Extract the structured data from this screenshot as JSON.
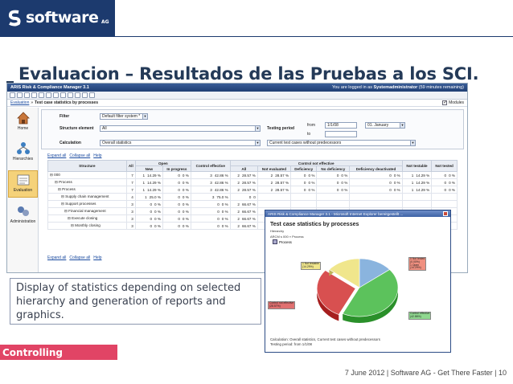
{
  "logo": {
    "text": "software",
    "suffix": "AG"
  },
  "slide": {
    "title": "Evaluacion – Resultados de las Pruebas a los SCI."
  },
  "app": {
    "title": "ARIS Risk & Compliance Manager 3.1",
    "login_prefix": "You are logged in as",
    "login_user": "Systemadministrator",
    "login_suffix": "(59 minutes remaining)",
    "breadcrumb": [
      "Evaluation",
      "Test case statistics by processes"
    ],
    "modules_label": "Modules",
    "sidebar": [
      {
        "label": "Home",
        "icon": "home-icon"
      },
      {
        "label": "Hierarchies",
        "icon": "hierarchy-icon"
      },
      {
        "label": "Evaluation",
        "icon": "evaluation-icon",
        "active": true
      },
      {
        "label": "Administration",
        "icon": "administration-icon"
      }
    ],
    "filter": {
      "filter_label": "Filter",
      "filter_value": "Default filter system *",
      "structure_label": "Structure element",
      "structure_value": "All",
      "period_label": "Testing period",
      "from_label": "from",
      "from_value": "1/1/08",
      "to_label": "to",
      "month_value": "01. January",
      "calc_label": "Calculation",
      "calc_value": "Overall statistics",
      "calc_value2": "Current test cases without predecessors"
    },
    "tools": {
      "expand": "Expand all",
      "collapse": "Collapse all",
      "help": "Help"
    },
    "table": {
      "headers": {
        "structure": "Structure",
        "all": "All",
        "open": "Open",
        "not_effective": "Control not effective",
        "control_effective": "Control effective",
        "not_testable": "Not testable",
        "not_tested": "Not tested",
        "new": "New",
        "in_progress": "In progress",
        "all2": "All",
        "not_evaluated": "Not evaluated",
        "deficiency": "Deficiency",
        "no_deficiency": "No deficiency",
        "def_deactivated": "Deficiency deactivated"
      },
      "rows": [
        {
          "name": "000",
          "all": "7",
          "new_n": "1",
          "new_p": "14.29 %",
          "ip_n": "0",
          "ip_p": "0 %",
          "ce_n": "3",
          "ce_p": "42.86 %",
          "ne_n": "2",
          "ne_p": "28.57 %",
          "nev_n": "2",
          "nev_p": "28.57 %",
          "d_n": "0",
          "d_p": "0 %",
          "nd_n": "0",
          "nd_p": "0 %",
          "dd_n": "0",
          "dd_p": "0 %",
          "nt_n": "1",
          "nt_p": "14.29 %",
          "nts_n": "0",
          "nts_p": "0 %"
        },
        {
          "name": "Process",
          "all": "7",
          "new_n": "1",
          "new_p": "14.29 %",
          "ip_n": "0",
          "ip_p": "0 %",
          "ce_n": "3",
          "ce_p": "42.86 %",
          "ne_n": "2",
          "ne_p": "28.57 %",
          "nev_n": "2",
          "nev_p": "28.57 %",
          "d_n": "0",
          "d_p": "0 %",
          "nd_n": "0",
          "nd_p": "0 %",
          "dd_n": "0",
          "dd_p": "0 %",
          "nt_n": "1",
          "nt_p": "14.29 %",
          "nts_n": "0",
          "nts_p": "0 %"
        },
        {
          "name": "Process",
          "all": "7",
          "new_n": "1",
          "new_p": "14.29 %",
          "ip_n": "0",
          "ip_p": "0 %",
          "ce_n": "3",
          "ce_p": "42.86 %",
          "ne_n": "2",
          "ne_p": "28.57 %",
          "nev_n": "2",
          "nev_p": "28.57 %",
          "d_n": "0",
          "d_p": "0 %",
          "nd_n": "0",
          "nd_p": "0 %",
          "dd_n": "0",
          "dd_p": "0 %",
          "nt_n": "1",
          "nt_p": "14.29 %",
          "nts_n": "0",
          "nts_p": "0 %"
        },
        {
          "name": "Supply chain management",
          "all": "4",
          "new_n": "1",
          "new_p": "25.0 %",
          "ip_n": "0",
          "ip_p": "0 %",
          "ce_n": "3",
          "ce_p": "75.0 %",
          "ne_n": "0",
          "ne_p": "0",
          "nev_n": "",
          "nev_p": "",
          "d_n": "",
          "d_p": "",
          "nd_n": "",
          "nd_p": "",
          "dd_n": "",
          "dd_p": "",
          "nt_n": "",
          "nt_p": "",
          "nts_n": "",
          "nts_p": ""
        },
        {
          "name": "Support processes",
          "all": "3",
          "new_n": "0",
          "new_p": "0 %",
          "ip_n": "0",
          "ip_p": "0 %",
          "ce_n": "0",
          "ce_p": "0 %",
          "ne_n": "2",
          "ne_p": "66.67 %",
          "nev_n": "",
          "nev_p": "",
          "d_n": "",
          "d_p": "",
          "nd_n": "",
          "nd_p": "",
          "dd_n": "",
          "dd_p": "",
          "nt_n": "",
          "nt_p": "",
          "nts_n": "",
          "nts_p": ""
        },
        {
          "name": "Financial management",
          "all": "3",
          "new_n": "0",
          "new_p": "0 %",
          "ip_n": "0",
          "ip_p": "0 %",
          "ce_n": "0",
          "ce_p": "0 %",
          "ne_n": "2",
          "ne_p": "66.67 %",
          "nev_n": "",
          "nev_p": "",
          "d_n": "",
          "d_p": "",
          "nd_n": "",
          "nd_p": "",
          "dd_n": "",
          "dd_p": "",
          "nt_n": "",
          "nt_p": "",
          "nts_n": "",
          "nts_p": ""
        },
        {
          "name": "Execute closing",
          "all": "3",
          "new_n": "0",
          "new_p": "0 %",
          "ip_n": "0",
          "ip_p": "0 %",
          "ce_n": "0",
          "ce_p": "0 %",
          "ne_n": "2",
          "ne_p": "66.67 %",
          "nev_n": "",
          "nev_p": "",
          "d_n": "",
          "d_p": "",
          "nd_n": "",
          "nd_p": "",
          "dd_n": "",
          "dd_p": "",
          "nt_n": "",
          "nt_p": "",
          "nts_n": "",
          "nts_p": ""
        },
        {
          "name": "Monthly closing",
          "all": "3",
          "new_n": "0",
          "new_p": "0 %",
          "ip_n": "0",
          "ip_p": "0 %",
          "ce_n": "0",
          "ce_p": "0 %",
          "ne_n": "2",
          "ne_p": "66.67 %",
          "nev_n": "",
          "nev_p": "",
          "d_n": "",
          "d_p": "",
          "nd_n": "",
          "nd_p": "",
          "dd_n": "",
          "dd_p": "",
          "nt_n": "",
          "nt_p": "",
          "nts_n": "",
          "nts_p": ""
        }
      ]
    }
  },
  "popup": {
    "window_title": "ARIS Risk & Compliance Manager 3.1 - Microsoft Internet Explorer bereitgestellt ...",
    "title": "Test case statistics by processes",
    "subtitle1": "Hierarchy",
    "subtitle2": "ARCM s 000 » Process",
    "process": "Process",
    "footer1": "Calculation: Overall statistics, Current test cases without predecessors",
    "footer2": "Testing period: from 1/1/08",
    "slices": [
      {
        "label": "Open",
        "value": 14.29,
        "pct": "(14.29%)",
        "color": "#8ab4de"
      },
      {
        "label": "Control effective",
        "value": 42.86,
        "pct": "(42.86%)",
        "color": "#5cc25c"
      },
      {
        "label": "Control not effective",
        "value": 28.57,
        "pct": "(28.57%)",
        "color": "#d85050"
      },
      {
        "label": "1 Not testable",
        "value": 14.29,
        "pct": "(14.29%)",
        "color": "#f0e68c"
      }
    ],
    "legend_top": [
      "0 Not tested",
      "(0.00%)",
      "1 Open",
      "(14.29%)"
    ]
  },
  "callout": "Display of statistics depending on selected hierarchy and generation of reports and graphics.",
  "controlling": "Controlling",
  "footer": "7 June 2012  |  Software AG - Get There Faster  |  10"
}
